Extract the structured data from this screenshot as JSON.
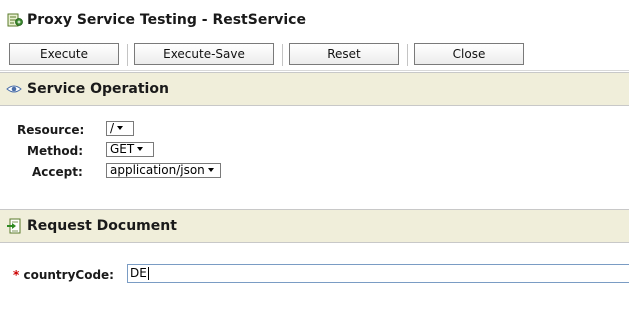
{
  "window": {
    "title": "Proxy Service Testing - RestService",
    "icon": "proxy-service-icon"
  },
  "toolbar": {
    "buttons": [
      {
        "label": "Execute"
      },
      {
        "label": "Execute-Save"
      },
      {
        "label": "Reset"
      },
      {
        "label": "Close"
      }
    ]
  },
  "service_operation": {
    "title": "Service Operation",
    "icon": "eye-icon",
    "fields": {
      "resource": {
        "label": "Resource:",
        "value": "/"
      },
      "method": {
        "label": "Method:",
        "value": "GET"
      },
      "accept": {
        "label": "Accept:",
        "value": "application/json"
      }
    }
  },
  "request_document": {
    "title": "Request Document",
    "icon": "document-arrow-icon",
    "fields": {
      "country_code": {
        "required_mark": "*",
        "label": "countryCode:",
        "value": "DE"
      }
    }
  },
  "colors": {
    "section_header_bg": "#f0eeda",
    "required_mark": "#cc0000"
  }
}
